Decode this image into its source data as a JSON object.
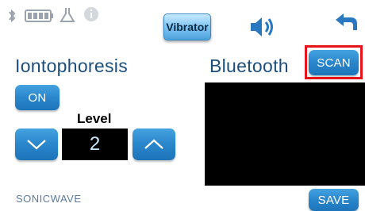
{
  "status_bar": {
    "icons": [
      "bluetooth-icon",
      "battery-icon",
      "flask-icon",
      "info-icon"
    ]
  },
  "toolbar": {
    "vibrator_label": "Vibrator",
    "sound_icon": "speaker-icon",
    "back_icon": "back-arrow-icon"
  },
  "iontophoresis": {
    "title": "Iontophoresis",
    "on_label": "ON",
    "level_label": "Level",
    "level_value": "2",
    "down_icon": "chevron-down-icon",
    "up_icon": "chevron-up-icon"
  },
  "bluetooth": {
    "title": "Bluetooth",
    "scan_label": "SCAN",
    "save_label": "SAVE"
  },
  "brand": {
    "logo_text": "SONICWAVE"
  },
  "colors": {
    "accent": "#2a86cb",
    "heading": "#1c4f7e",
    "highlight": "#e8141b"
  }
}
